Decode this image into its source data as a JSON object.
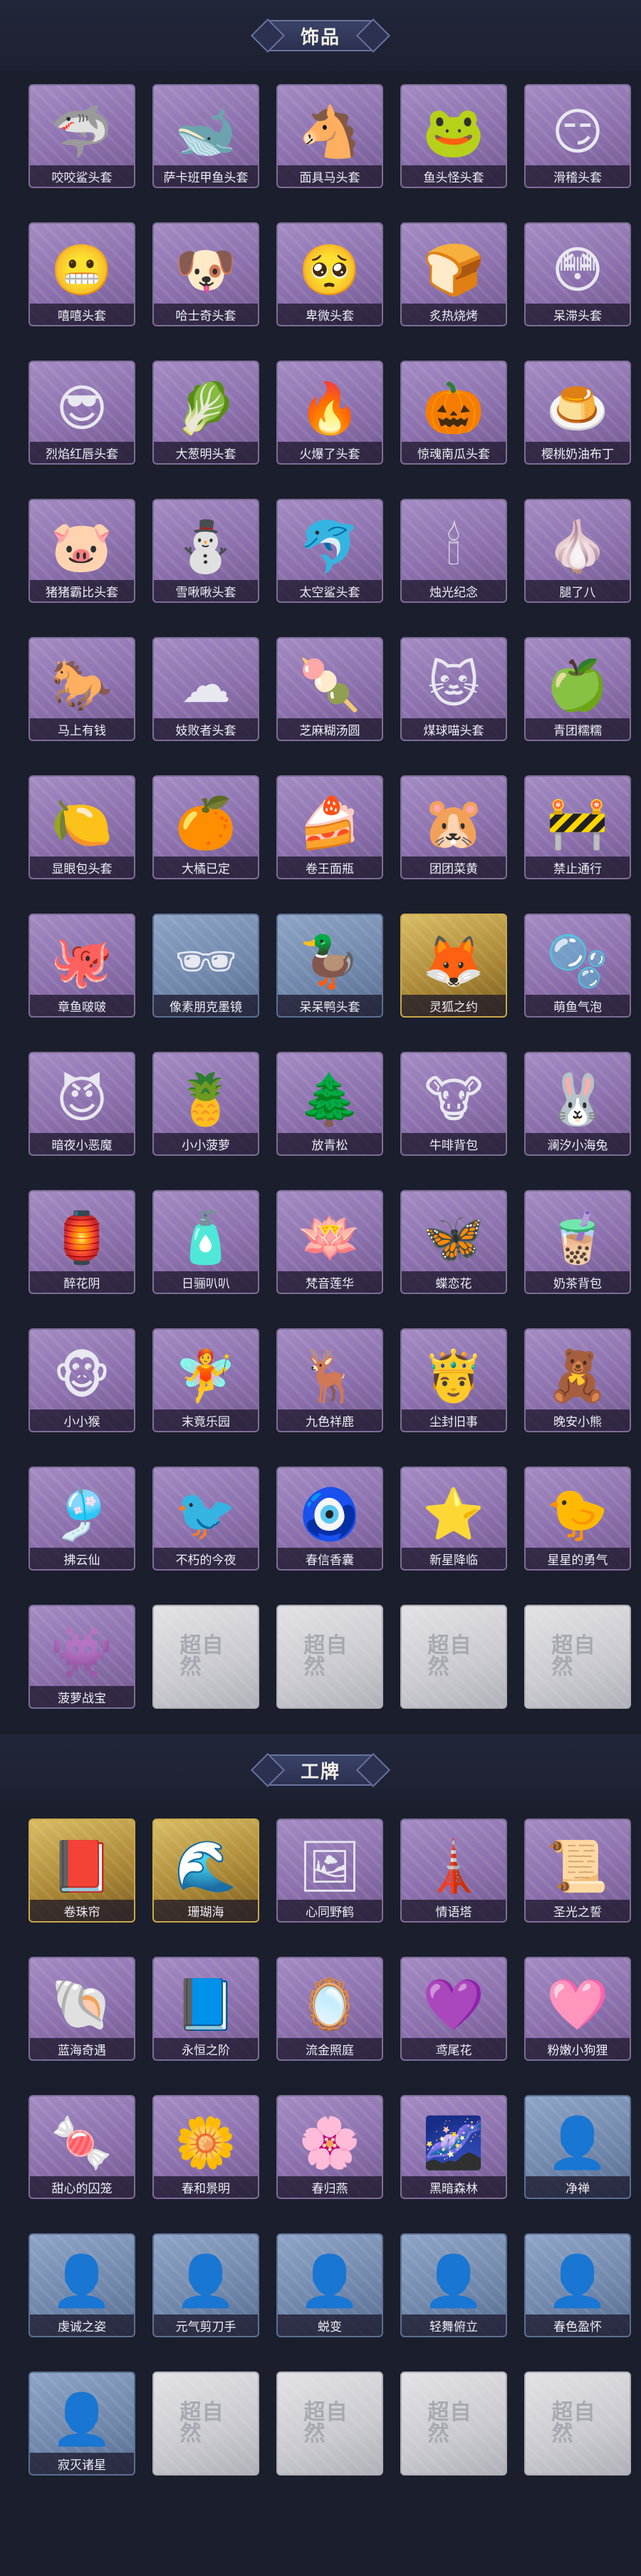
{
  "sections": [
    {
      "title": "饰品",
      "items": [
        {
          "label": "咬咬鲨头套",
          "icon": "shark-head-icon",
          "glyph": "🦈",
          "variant": "purple"
        },
        {
          "label": "萨卡班甲鱼头套",
          "icon": "fish-head-icon",
          "glyph": "🐋",
          "variant": "purple"
        },
        {
          "label": "面具马头套",
          "icon": "horse-head-icon",
          "glyph": "🐴",
          "variant": "purple"
        },
        {
          "label": "鱼头怪头套",
          "icon": "fish-monster-head-icon",
          "glyph": "🐸",
          "variant": "purple"
        },
        {
          "label": "滑稽头套",
          "icon": "funny-face-icon",
          "glyph": "😏",
          "variant": "purple"
        },
        {
          "label": "嘻嘻头套",
          "icon": "grin-face-icon",
          "glyph": "😬",
          "variant": "purple"
        },
        {
          "label": "哈士奇头套",
          "icon": "husky-head-icon",
          "glyph": "🐶",
          "variant": "purple"
        },
        {
          "label": "卑微头套",
          "icon": "humble-face-icon",
          "glyph": "🥺",
          "variant": "purple"
        },
        {
          "label": "炙热烧烤",
          "icon": "toast-head-icon",
          "glyph": "🍞",
          "variant": "purple"
        },
        {
          "label": "呆滞头套",
          "icon": "dazed-face-icon",
          "glyph": "😳",
          "variant": "purple"
        },
        {
          "label": "烈焰红唇头套",
          "icon": "pikachu-head-icon",
          "glyph": "😎",
          "variant": "purple"
        },
        {
          "label": "大葱明头套",
          "icon": "scallion-head-icon",
          "glyph": "🥬",
          "variant": "purple"
        },
        {
          "label": "火爆了头套",
          "icon": "fire-head-icon",
          "glyph": "🔥",
          "variant": "purple"
        },
        {
          "label": "惊魂南瓜头套",
          "icon": "pumpkin-head-icon",
          "glyph": "🎃",
          "variant": "purple"
        },
        {
          "label": "樱桃奶油布丁",
          "icon": "pudding-head-icon",
          "glyph": "🍮",
          "variant": "purple"
        },
        {
          "label": "猪猪霸比头套",
          "icon": "pig-head-icon",
          "glyph": "🐷",
          "variant": "purple"
        },
        {
          "label": "雪啾啾头套",
          "icon": "snowman-head-icon",
          "glyph": "⛄",
          "variant": "purple"
        },
        {
          "label": "太空鲨头套",
          "icon": "space-shark-icon",
          "glyph": "🐬",
          "variant": "purple"
        },
        {
          "label": "烛光纪念",
          "icon": "candle-icon",
          "glyph": "🕯",
          "variant": "purple"
        },
        {
          "label": "腿了八",
          "icon": "turnip-icon",
          "glyph": "🧄",
          "variant": "purple"
        },
        {
          "label": "马上有钱",
          "icon": "horse-money-icon",
          "glyph": "🐎",
          "variant": "purple"
        },
        {
          "label": "妓败者头套",
          "icon": "cloud-head-icon",
          "glyph": "☁",
          "variant": "purple"
        },
        {
          "label": "芝麻糊汤圆",
          "icon": "dumpling-icon",
          "glyph": "🍡",
          "variant": "purple"
        },
        {
          "label": "煤球喵头套",
          "icon": "black-cat-icon",
          "glyph": "🐱",
          "variant": "purple"
        },
        {
          "label": "青团糯糯",
          "icon": "green-ball-icon",
          "glyph": "🍏",
          "variant": "purple"
        },
        {
          "label": "显眼包头套",
          "icon": "showoff-head-icon",
          "glyph": "🍋",
          "variant": "purple"
        },
        {
          "label": "大橘已定",
          "icon": "orange-head-icon",
          "glyph": "🍊",
          "variant": "purple"
        },
        {
          "label": "卷王面瓶",
          "icon": "cake-roll-icon",
          "glyph": "🍰",
          "variant": "purple"
        },
        {
          "label": "团团菜黄",
          "icon": "cat-bun-icon",
          "glyph": "🐹",
          "variant": "purple"
        },
        {
          "label": "禁止通行",
          "icon": "no-entry-icon",
          "glyph": "🚧",
          "variant": "purple"
        },
        {
          "label": "章鱼啵啵",
          "icon": "octopus-icon",
          "glyph": "🐙",
          "variant": "purple"
        },
        {
          "label": "像素朋克墨镜",
          "icon": "pixel-glasses-icon",
          "glyph": "🕶",
          "variant": "blue"
        },
        {
          "label": "呆呆鸭头套",
          "icon": "duck-head-icon",
          "glyph": "🦆",
          "variant": "blue"
        },
        {
          "label": "灵狐之约",
          "icon": "fox-mask-icon",
          "glyph": "🦊",
          "variant": "gold"
        },
        {
          "label": "萌鱼气泡",
          "icon": "fish-bubble-icon",
          "glyph": "🫧",
          "variant": "purple"
        },
        {
          "label": "暗夜小恶魔",
          "icon": "little-devil-icon",
          "glyph": "😈",
          "variant": "purple"
        },
        {
          "label": "小小菠萝",
          "icon": "pineapple-icon",
          "glyph": "🍍",
          "variant": "purple"
        },
        {
          "label": "放青松",
          "icon": "bonsai-icon",
          "glyph": "🌲",
          "variant": "purple"
        },
        {
          "label": "牛啡背包",
          "icon": "cow-bag-icon",
          "glyph": "🐮",
          "variant": "purple"
        },
        {
          "label": "澜汐小海兔",
          "icon": "sea-bunny-icon",
          "glyph": "🐰",
          "variant": "purple"
        },
        {
          "label": "醉花阴",
          "icon": "flower-charm-icon",
          "glyph": "🏮",
          "variant": "purple"
        },
        {
          "label": "日骊叭叭",
          "icon": "bottle-charm-icon",
          "glyph": "🧴",
          "variant": "purple"
        },
        {
          "label": "梵音莲华",
          "icon": "lotus-charm-icon",
          "glyph": "🪷",
          "variant": "purple"
        },
        {
          "label": "蝶恋花",
          "icon": "butterfly-charm-icon",
          "glyph": "🦋",
          "variant": "purple"
        },
        {
          "label": "奶茶背包",
          "icon": "milktea-bag-icon",
          "glyph": "🧋",
          "variant": "purple"
        },
        {
          "label": "小小猴",
          "icon": "monkey-charm-icon",
          "glyph": "🐵",
          "variant": "purple"
        },
        {
          "label": "末竟乐园",
          "icon": "doll-charm-icon",
          "glyph": "🧚",
          "variant": "purple"
        },
        {
          "label": "九色祥鹿",
          "icon": "deer-charm-icon",
          "glyph": "🦌",
          "variant": "purple"
        },
        {
          "label": "尘封旧事",
          "icon": "figure-charm-icon",
          "glyph": "🤴",
          "variant": "purple"
        },
        {
          "label": "晚安小熊",
          "icon": "bear-charm-icon",
          "glyph": "🧸",
          "variant": "purple"
        },
        {
          "label": "拂云仙",
          "icon": "cloud-fairy-icon",
          "glyph": "🎐",
          "variant": "purple"
        },
        {
          "label": "不朽的今夜",
          "icon": "pink-bird-icon",
          "glyph": "🐦",
          "variant": "purple"
        },
        {
          "label": "春信香囊",
          "icon": "sachet-icon",
          "glyph": "🧿",
          "variant": "purple"
        },
        {
          "label": "新星降临",
          "icon": "star-charm-icon",
          "glyph": "⭐",
          "variant": "purple"
        },
        {
          "label": "星星的勇气",
          "icon": "courage-charm-icon",
          "glyph": "🐤",
          "variant": "purple"
        },
        {
          "label": "菠萝战宝",
          "icon": "pineapple-warrior-icon",
          "glyph": "👾",
          "variant": "purple"
        },
        {
          "label": "",
          "icon": "empty-slot-logo",
          "glyph": "超自然",
          "variant": "empty"
        },
        {
          "label": "",
          "icon": "empty-slot-logo",
          "glyph": "超自然",
          "variant": "empty"
        },
        {
          "label": "",
          "icon": "empty-slot-logo",
          "glyph": "超自然",
          "variant": "empty"
        },
        {
          "label": "",
          "icon": "empty-slot-logo",
          "glyph": "超自然",
          "variant": "empty"
        }
      ]
    },
    {
      "title": "工牌",
      "items": [
        {
          "label": "卷珠帘",
          "icon": "ruby-badge-icon",
          "glyph": "📕",
          "variant": "gold"
        },
        {
          "label": "珊瑚海",
          "icon": "coral-badge-icon",
          "glyph": "🌊",
          "variant": "gold"
        },
        {
          "label": "心同野鹤",
          "icon": "crane-badge-icon",
          "glyph": "🖼",
          "variant": "purple"
        },
        {
          "label": "情语塔",
          "icon": "tower-badge-icon",
          "glyph": "🗼",
          "variant": "purple"
        },
        {
          "label": "圣光之誓",
          "icon": "holy-badge-icon",
          "glyph": "📜",
          "variant": "purple"
        },
        {
          "label": "蓝海奇遇",
          "icon": "bluesea-badge-icon",
          "glyph": "🐚",
          "variant": "purple"
        },
        {
          "label": "永恒之阶",
          "icon": "stairs-badge-icon",
          "glyph": "📘",
          "variant": "purple"
        },
        {
          "label": "流金照庭",
          "icon": "golden-badge-icon",
          "glyph": "🪞",
          "variant": "purple"
        },
        {
          "label": "鸢尾花",
          "icon": "iris-badge-icon",
          "glyph": "💜",
          "variant": "purple"
        },
        {
          "label": "粉嫩小狗狸",
          "icon": "pink-badge-icon",
          "glyph": "🩷",
          "variant": "purple"
        },
        {
          "label": "甜心的囚笼",
          "icon": "candy-badge-icon",
          "glyph": "🍬",
          "variant": "purple"
        },
        {
          "label": "春和景明",
          "icon": "spring-badge-icon",
          "glyph": "🌼",
          "variant": "purple"
        },
        {
          "label": "春归燕",
          "icon": "swallow-badge-icon",
          "glyph": "🌸",
          "variant": "purple"
        },
        {
          "label": "黑暗森林",
          "icon": "darkforest-badge-icon",
          "glyph": "🌌",
          "variant": "purple"
        },
        {
          "label": "净禅",
          "icon": "silhouette-badge-icon",
          "glyph": "👤",
          "variant": "blue"
        },
        {
          "label": "虔诚之姿",
          "icon": "silhouette-badge-icon",
          "glyph": "👤",
          "variant": "blue"
        },
        {
          "label": "元气剪刀手",
          "icon": "silhouette-badge-icon",
          "glyph": "👤",
          "variant": "blue"
        },
        {
          "label": "蜕变",
          "icon": "silhouette-badge-icon",
          "glyph": "👤",
          "variant": "blue"
        },
        {
          "label": "轻舞俯立",
          "icon": "silhouette-badge-icon",
          "glyph": "👤",
          "variant": "blue"
        },
        {
          "label": "春色盈怀",
          "icon": "silhouette-badge-icon",
          "glyph": "👤",
          "variant": "blue"
        },
        {
          "label": "寂灭诸星",
          "icon": "silhouette-badge-icon",
          "glyph": "👤",
          "variant": "blue"
        },
        {
          "label": "",
          "icon": "empty-slot-logo",
          "glyph": "超自然",
          "variant": "empty"
        },
        {
          "label": "",
          "icon": "empty-slot-logo",
          "glyph": "超自然",
          "variant": "empty"
        },
        {
          "label": "",
          "icon": "empty-slot-logo",
          "glyph": "超自然",
          "variant": "empty"
        },
        {
          "label": "",
          "icon": "empty-slot-logo",
          "glyph": "超自然",
          "variant": "empty"
        }
      ]
    }
  ]
}
